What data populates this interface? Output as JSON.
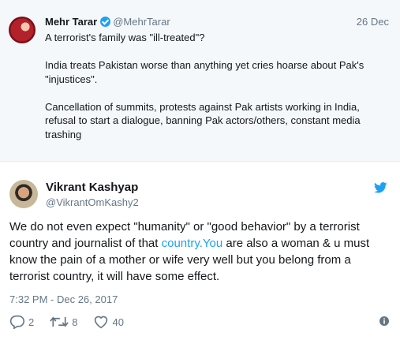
{
  "parent_tweet": {
    "name": "Mehr Tarar",
    "handle": "@MehrTarar",
    "date": "26 Dec",
    "paragraphs": [
      "A terrorist's family was \"ill-treated\"?",
      "India treats Pakistan worse than anything yet cries hoarse about Pak's \"injustices\".",
      "Cancellation of summits, protests against Pak artists working in India, refusal to start a dialogue, banning Pak actors/others, constant media trashing"
    ]
  },
  "tweet": {
    "name": "Vikrant Kashyap",
    "handle": "@VikrantOmKashy2",
    "text_before_link": "We do not even expect \"humanity\" or \"good behavior\" by a terrorist country and journalist of that ",
    "link_text": "country.You",
    "text_after_link": " are also a woman & u must know the pain of a mother or wife very well but you belong from a terrorist country, it will have some effect.",
    "timestamp": "7:32 PM - Dec 26, 2017"
  },
  "actions": {
    "replies": "2",
    "retweets": "8",
    "likes": "40"
  },
  "colors": {
    "accent": "#1da1f2",
    "muted": "#657786",
    "parent_bg": "#f5f8fa"
  }
}
